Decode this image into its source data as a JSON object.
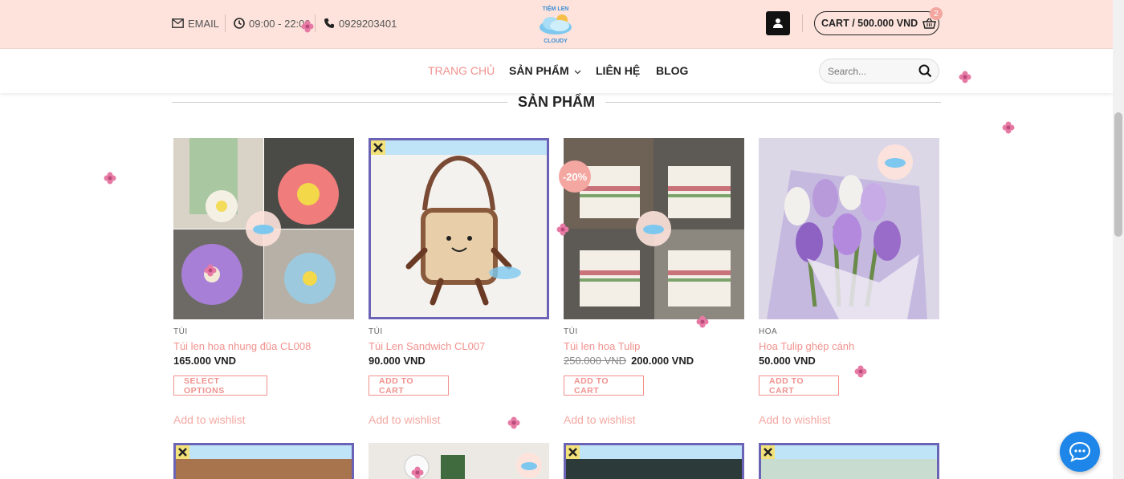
{
  "header": {
    "email_label": "EMAIL",
    "hours": "09:00 - 22:00",
    "phone": "0929203401",
    "logo_text_top": "TIỆM LEN",
    "logo_text_bottom": "CLOUDY",
    "cart_label": "CART / 500.000 VND",
    "cart_count": "2"
  },
  "nav": {
    "items": [
      {
        "label": "TRANG CHỦ",
        "active": true
      },
      {
        "label": "SẢN PHẨM"
      },
      {
        "label": "LIÊN HỆ"
      },
      {
        "label": "BLOG"
      }
    ],
    "search_placeholder": "Search..."
  },
  "section": {
    "title": "SẢN PHẨM"
  },
  "products": [
    {
      "category": "TÚI",
      "name": "Túi len hoa nhung đũa CL008",
      "price": "165.000 VND",
      "button": "SELECT OPTIONS",
      "wishlist": "Add to wishlist"
    },
    {
      "category": "TÚI",
      "name": "Túi Len Sandwich CL007",
      "price": "90.000 VND",
      "button": "ADD TO CART",
      "wishlist": "Add to wishlist"
    },
    {
      "category": "TÚI",
      "name": "Túi len hoa Tulip",
      "old_price": "250.000 VND",
      "price": "200.000 VND",
      "badge": "-20%",
      "button": "ADD TO CART",
      "wishlist": "Add to wishlist"
    },
    {
      "category": "HOA",
      "name": "Hoa Tulip ghép cánh",
      "price": "50.000 VND",
      "button": "ADD TO CART",
      "wishlist": "Add to wishlist"
    }
  ],
  "colors": {
    "topbar_bg": "#fde3dc",
    "accent_pink": "#f0928e",
    "chat_blue": "#1d86e8",
    "frame_purple": "#6b63b5",
    "frame_lightblue": "#bfe3f7"
  }
}
